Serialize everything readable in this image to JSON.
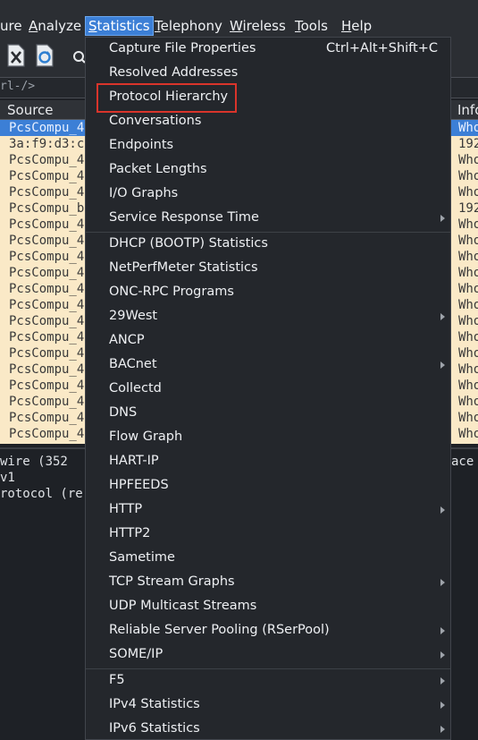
{
  "menubar": {
    "items": [
      {
        "label": "ure",
        "name": "menu-capture"
      },
      {
        "label": "Analyze",
        "name": "menu-analyze"
      },
      {
        "label": "Statistics",
        "name": "menu-statistics"
      },
      {
        "label": "Telephony",
        "name": "menu-telephony"
      },
      {
        "label": "Wireless",
        "name": "menu-wireless"
      },
      {
        "label": "Tools",
        "name": "menu-tools"
      },
      {
        "label": "Help",
        "name": "menu-help"
      }
    ]
  },
  "filter": {
    "text": "rl-/>"
  },
  "packet_list": {
    "columns": {
      "source": "Source",
      "info": "Info"
    },
    "rows": [
      {
        "source": "PcsCompu_4",
        "info": "Who",
        "selected": true
      },
      {
        "source": "3a:f9:d3:c",
        "info": "192"
      },
      {
        "source": "PcsCompu_4",
        "info": "Who"
      },
      {
        "source": "PcsCompu_4",
        "info": "Who"
      },
      {
        "source": "PcsCompu_4",
        "info": "Who"
      },
      {
        "source": "PcsCompu_b",
        "info": "192"
      },
      {
        "source": "PcsCompu_4",
        "info": "Who"
      },
      {
        "source": "PcsCompu_4",
        "info": "Who"
      },
      {
        "source": "PcsCompu_4",
        "info": "Who"
      },
      {
        "source": "PcsCompu_4",
        "info": "Who"
      },
      {
        "source": "PcsCompu_4",
        "info": "Who"
      },
      {
        "source": "PcsCompu_4",
        "info": "Who"
      },
      {
        "source": "PcsCompu_4",
        "info": "Who"
      },
      {
        "source": "PcsCompu_4",
        "info": "Who"
      },
      {
        "source": "PcsCompu_4",
        "info": "Who"
      },
      {
        "source": "PcsCompu_4",
        "info": "Who"
      },
      {
        "source": "PcsCompu_4",
        "info": "Who"
      },
      {
        "source": "PcsCompu_4",
        "info": "Who"
      },
      {
        "source": "PcsCompu_4",
        "info": "Who"
      },
      {
        "source": "PcsCompu_4",
        "info": "Who"
      }
    ]
  },
  "details": {
    "lines": [
      " wire (352",
      " v1",
      "rotocol (re"
    ],
    "right_fragment": "ace"
  },
  "statistics_menu": {
    "items": [
      {
        "label": "Capture File Properties",
        "shortcut": "Ctrl+Alt+Shift+C",
        "submenu": false
      },
      {
        "label": "Resolved Addresses",
        "submenu": false
      },
      {
        "label": "Protocol Hierarchy",
        "submenu": false,
        "highlighted": true
      },
      {
        "label": "Conversations",
        "submenu": false
      },
      {
        "label": "Endpoints",
        "submenu": false
      },
      {
        "label": "Packet Lengths",
        "submenu": false
      },
      {
        "label": "I/O Graphs",
        "submenu": false
      },
      {
        "label": "Service Response Time",
        "submenu": true,
        "separator_after": true
      },
      {
        "label": "DHCP (BOOTP) Statistics",
        "submenu": false
      },
      {
        "label": "NetPerfMeter Statistics",
        "submenu": false
      },
      {
        "label": "ONC-RPC Programs",
        "submenu": false
      },
      {
        "label": "29West",
        "submenu": true
      },
      {
        "label": "ANCP",
        "submenu": false
      },
      {
        "label": "BACnet",
        "submenu": true
      },
      {
        "label": "Collectd",
        "submenu": false
      },
      {
        "label": "DNS",
        "submenu": false
      },
      {
        "label": "Flow Graph",
        "submenu": false
      },
      {
        "label": "HART-IP",
        "submenu": false
      },
      {
        "label": "HPFEEDS",
        "submenu": false
      },
      {
        "label": "HTTP",
        "submenu": true
      },
      {
        "label": "HTTP2",
        "submenu": false
      },
      {
        "label": "Sametime",
        "submenu": false
      },
      {
        "label": "TCP Stream Graphs",
        "submenu": true
      },
      {
        "label": "UDP Multicast Streams",
        "submenu": false
      },
      {
        "label": "Reliable Server Pooling (RSerPool)",
        "submenu": true
      },
      {
        "label": "SOME/IP",
        "submenu": true,
        "separator_after": true
      },
      {
        "label": "F5",
        "submenu": true
      },
      {
        "label": "IPv4 Statistics",
        "submenu": true
      },
      {
        "label": "IPv6 Statistics",
        "submenu": true
      }
    ]
  },
  "colors": {
    "menu_bg": "#24272c",
    "selection": "#3c7fd6",
    "packet_row_bg": "#fae9c7",
    "highlight_box": "#d9342b"
  }
}
